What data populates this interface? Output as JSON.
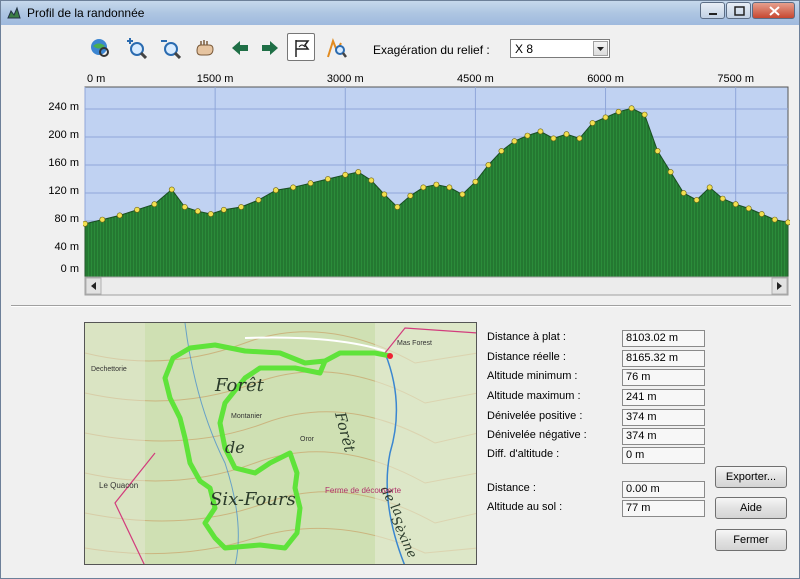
{
  "window": {
    "title": "Profil de la randonnée"
  },
  "toolbar": {
    "buttons": [
      {
        "name": "globe-search-icon"
      },
      {
        "name": "zoom-in-icon"
      },
      {
        "name": "zoom-out-icon"
      },
      {
        "name": "pan-hand-icon"
      },
      {
        "name": "arrow-left-icon"
      },
      {
        "name": "arrow-right-icon"
      },
      {
        "name": "profile-flag-icon",
        "pressed": true
      },
      {
        "name": "route-search-icon"
      }
    ],
    "exaggeration_label": "Exagération du relief :",
    "exaggeration_value": "X 8"
  },
  "chart_data": {
    "type": "area",
    "x_ticks": [
      "0 m",
      "1500 m",
      "3000 m",
      "4500 m",
      "6000 m",
      "7500 m"
    ],
    "y_ticks": [
      "240 m",
      "200 m",
      "160 m",
      "120 m",
      "80 m",
      "40 m",
      "0 m"
    ],
    "x_range": [
      0,
      8103
    ],
    "y_range": [
      0,
      260
    ],
    "grid": true,
    "colors": {
      "sky": "#c0d2f2",
      "fill": "#2b8c3a",
      "points": "#f2e050",
      "grid": "#8fa6d9"
    },
    "x": [
      0,
      200,
      400,
      600,
      800,
      1000,
      1150,
      1300,
      1450,
      1600,
      1800,
      2000,
      2200,
      2400,
      2600,
      2800,
      3000,
      3150,
      3300,
      3450,
      3600,
      3750,
      3900,
      4050,
      4200,
      4350,
      4500,
      4650,
      4800,
      4950,
      5100,
      5250,
      5400,
      5550,
      5700,
      5850,
      6000,
      6150,
      6300,
      6450,
      6600,
      6750,
      6900,
      7050,
      7200,
      7350,
      7500,
      7650,
      7800,
      7950,
      8103
    ],
    "y": [
      76,
      82,
      88,
      96,
      104,
      125,
      100,
      94,
      90,
      96,
      100,
      110,
      124,
      128,
      134,
      140,
      146,
      150,
      138,
      118,
      100,
      116,
      128,
      132,
      128,
      118,
      136,
      160,
      180,
      194,
      202,
      208,
      198,
      204,
      198,
      220,
      228,
      236,
      241,
      232,
      180,
      150,
      120,
      110,
      128,
      112,
      104,
      98,
      90,
      82,
      78
    ]
  },
  "map": {
    "labels": [
      "Forêt",
      "de",
      "Six-Fours",
      "Forêt",
      "de la",
      "Sèxine",
      "Ferme de découverte",
      "Le Quacon",
      "Dechettorie",
      "Mas Forest",
      "Oror",
      "Montanier"
    ]
  },
  "stats": [
    {
      "label": "Distance à plat :",
      "value": "8103.02 m"
    },
    {
      "label": "Distance réelle :",
      "value": "8165.32 m"
    },
    {
      "label": "Altitude minimum :",
      "value": "76 m"
    },
    {
      "label": "Altitude maximum :",
      "value": "241 m"
    },
    {
      "label": "Dénivelée positive :",
      "value": "374 m"
    },
    {
      "label": "Dénivelée négative :",
      "value": "374 m"
    },
    {
      "label": "Diff. d'altitude :",
      "value": "0 m"
    }
  ],
  "cursor": [
    {
      "label": "Distance :",
      "value": "0.00 m"
    },
    {
      "label": "Altitude au sol :",
      "value": "77 m"
    }
  ],
  "buttons": {
    "export": "Exporter...",
    "help": "Aide",
    "close": "Fermer"
  }
}
